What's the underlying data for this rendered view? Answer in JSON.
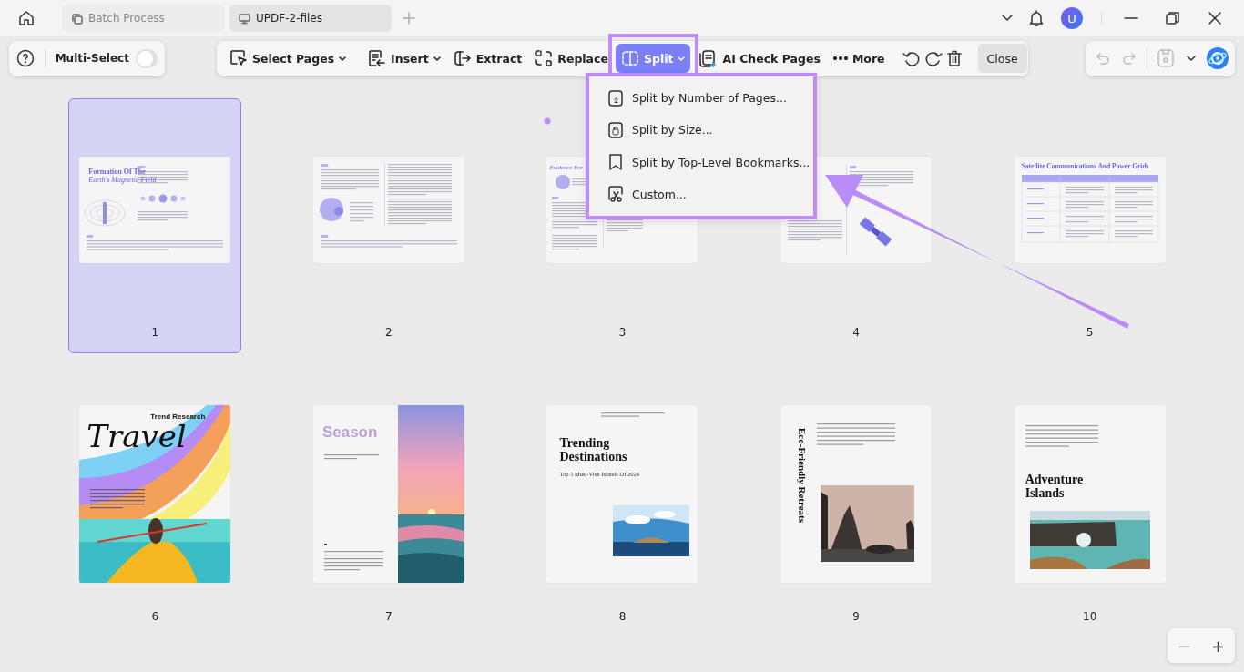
{
  "tabs": [
    {
      "label": "Batch Process",
      "selected": false
    },
    {
      "label": "UPDF-2-files",
      "selected": true
    }
  ],
  "user": {
    "initial": "U"
  },
  "multi_select": {
    "label": "Multi-Select",
    "on": false
  },
  "toolbar": {
    "items": [
      {
        "kind": "button",
        "label": "Select Pages",
        "dropdown": true,
        "selected": false
      },
      {
        "kind": "separator"
      },
      {
        "kind": "button",
        "label": "Insert",
        "dropdown": true,
        "selected": false
      },
      {
        "kind": "button",
        "label": "Extract",
        "dropdown": false,
        "selected": false
      },
      {
        "kind": "button",
        "label": "Replace",
        "dropdown": false,
        "selected": false
      },
      {
        "kind": "button",
        "label": "Split",
        "dropdown": true,
        "selected": true
      },
      {
        "kind": "button",
        "label": "AI Check Pages",
        "dropdown": false,
        "selected": false
      },
      {
        "kind": "button",
        "label": "More",
        "dropdown": false,
        "selected": false
      },
      {
        "kind": "separator"
      },
      {
        "kind": "icon_button"
      },
      {
        "kind": "icon_button"
      },
      {
        "kind": "icon_button"
      },
      {
        "kind": "separator"
      },
      {
        "kind": "plain_button",
        "label": "Close"
      }
    ]
  },
  "right_toolbar": {
    "items": [
      {
        "kind": "icon_button",
        "disabled": true
      },
      {
        "kind": "icon_button",
        "disabled": true
      },
      {
        "kind": "separator"
      },
      {
        "kind": "icon_button",
        "disabled": true
      },
      {
        "kind": "caret"
      },
      {
        "kind": "logo"
      }
    ]
  },
  "split_menu": {
    "items": [
      {
        "label": "Split by Number of Pages..."
      },
      {
        "label": "Split by Size..."
      },
      {
        "label": "Split by Top-Level Bookmarks..."
      },
      {
        "label": "Custom..."
      }
    ]
  },
  "pages": [
    {
      "number": "1",
      "selected": true,
      "kind": "landscape",
      "titles": [
        {
          "text": "Formation Of The",
          "kind": "heading"
        },
        {
          "text": "Earth's Magnetic Field",
          "kind": "italic"
        }
      ]
    },
    {
      "number": "2",
      "selected": false,
      "kind": "landscape"
    },
    {
      "number": "3",
      "selected": false,
      "kind": "landscape",
      "titles": [
        {
          "text": "Evidence For",
          "kind": "italic"
        }
      ]
    },
    {
      "number": "4",
      "selected": false,
      "kind": "landscape"
    },
    {
      "number": "5",
      "selected": false,
      "kind": "landscape",
      "titles": [
        {
          "text": "Satellite Communications And Power Grids",
          "kind": "heading"
        }
      ]
    },
    {
      "number": "6",
      "selected": false,
      "kind": "portrait",
      "titles": [
        {
          "text": "Trend Research",
          "kind": "label"
        },
        {
          "text": "Travel",
          "kind": "script"
        }
      ]
    },
    {
      "number": "7",
      "selected": false,
      "kind": "portrait",
      "titles": [
        {
          "text": "Season",
          "kind": "display"
        }
      ]
    },
    {
      "number": "8",
      "selected": false,
      "kind": "portrait",
      "titles": [
        {
          "text": "Trending Destinations",
          "kind": "big"
        },
        {
          "text": "Top 5 Must-Visit Islands Of 2024",
          "kind": "subtitle"
        }
      ]
    },
    {
      "number": "9",
      "selected": false,
      "kind": "portrait",
      "titles": [
        {
          "text": "Eco-Friendly Retreats",
          "kind": "vertical"
        }
      ]
    },
    {
      "number": "10",
      "selected": false,
      "kind": "portrait",
      "titles": [
        {
          "text": "Adventure Islands",
          "kind": "big"
        }
      ]
    }
  ],
  "zoom": {
    "out": "−",
    "in": "+"
  }
}
